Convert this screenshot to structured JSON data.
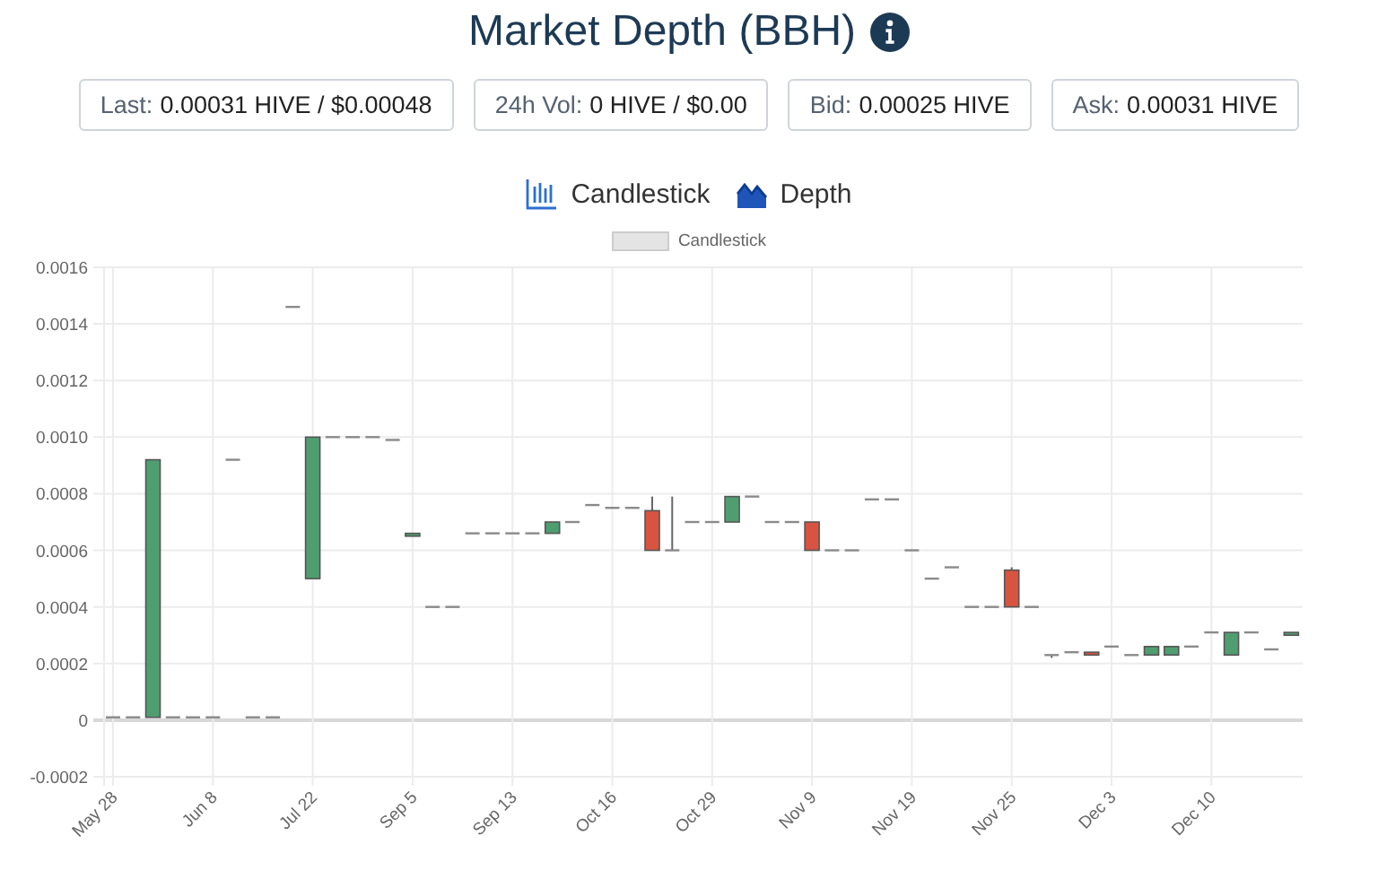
{
  "title": "Market Depth (BBH)",
  "stats": [
    {
      "label": "Last:",
      "value": "0.00031 HIVE / $0.00048"
    },
    {
      "label": "24h Vol:",
      "value": "0 HIVE / $0.00"
    },
    {
      "label": "Bid:",
      "value": "0.00025 HIVE"
    },
    {
      "label": "Ask:",
      "value": "0.00031 HIVE"
    }
  ],
  "chart_types": [
    {
      "kind": "candlestick",
      "label": "Candlestick"
    },
    {
      "kind": "depth",
      "label": "Depth"
    }
  ],
  "chart": {
    "chart_data": {
      "type": "candlestick",
      "grid": true,
      "categories": [
        "May 28",
        null,
        null,
        null,
        null,
        "Jun 8",
        null,
        null,
        null,
        null,
        "Jul 22",
        null,
        null,
        null,
        null,
        "Sep 5",
        null,
        null,
        null,
        null,
        "Sep 13",
        null,
        null,
        null,
        null,
        "Oct 16",
        null,
        null,
        null,
        null,
        "Oct 29",
        null,
        null,
        null,
        null,
        "Nov 9",
        null,
        null,
        null,
        null,
        "Nov 19",
        null,
        null,
        null,
        null,
        "Nov 25",
        null,
        null,
        null,
        null,
        "Dec 3",
        null,
        null,
        null,
        null,
        "Dec 10",
        null,
        null,
        null,
        null
      ],
      "ylim": [
        -0.0002,
        0.0016
      ],
      "yticks": [
        {
          "value": -0.0002,
          "label": "-0.0002"
        },
        {
          "value": 0,
          "label": "0"
        },
        {
          "value": 0.0002,
          "label": "0.0002"
        },
        {
          "value": 0.0004,
          "label": "0.0004"
        },
        {
          "value": 0.0006,
          "label": "0.0006"
        },
        {
          "value": 0.0008,
          "label": "0.0008"
        },
        {
          "value": 0.001,
          "label": "0.0010"
        },
        {
          "value": 0.0012,
          "label": "0.0012"
        },
        {
          "value": 0.0014,
          "label": "0.0014"
        },
        {
          "value": 0.0016,
          "label": "0.0016"
        }
      ],
      "series": [
        {
          "name": "Candlestick",
          "ohlc": [
            [
              1e-05,
              1e-05,
              1e-05,
              1e-05
            ],
            [
              1e-05,
              1e-05,
              1e-05,
              1e-05
            ],
            [
              1e-05,
              0.00092,
              1e-05,
              0.00092
            ],
            [
              1e-05,
              1e-05,
              1e-05,
              1e-05
            ],
            [
              1e-05,
              1e-05,
              1e-05,
              1e-05
            ],
            [
              1e-05,
              1e-05,
              1e-05,
              1e-05
            ],
            [
              0.00092,
              0.00092,
              0.00092,
              0.00092
            ],
            [
              1e-05,
              1e-05,
              1e-05,
              1e-05
            ],
            [
              1e-05,
              1e-05,
              1e-05,
              1e-05
            ],
            [
              0.00146,
              0.00146,
              0.00146,
              0.00146
            ],
            [
              0.0005,
              0.001,
              0.0005,
              0.001
            ],
            [
              0.001,
              0.001,
              0.001,
              0.001
            ],
            [
              0.001,
              0.001,
              0.001,
              0.001
            ],
            [
              0.001,
              0.001,
              0.001,
              0.001
            ],
            [
              0.00099,
              0.00099,
              0.00099,
              0.00099
            ],
            [
              0.00065,
              0.00066,
              0.00065,
              0.00066
            ],
            [
              0.0004,
              0.0004,
              0.0004,
              0.0004
            ],
            [
              0.0004,
              0.0004,
              0.0004,
              0.0004
            ],
            [
              0.00066,
              0.00066,
              0.00066,
              0.00066
            ],
            [
              0.00066,
              0.00066,
              0.00066,
              0.00066
            ],
            [
              0.00066,
              0.00066,
              0.00066,
              0.00066
            ],
            [
              0.00066,
              0.00066,
              0.00066,
              0.00066
            ],
            [
              0.00066,
              0.0007,
              0.00066,
              0.0007
            ],
            [
              0.0007,
              0.0007,
              0.0007,
              0.0007
            ],
            [
              0.00076,
              0.00076,
              0.00076,
              0.00076
            ],
            [
              0.00075,
              0.00075,
              0.00075,
              0.00075
            ],
            [
              0.00075,
              0.00075,
              0.00075,
              0.00075
            ],
            [
              0.00074,
              0.00079,
              0.0006,
              0.0006
            ],
            [
              0.0006,
              0.00079,
              0.0006,
              0.0006
            ],
            [
              0.0007,
              0.0007,
              0.0007,
              0.0007
            ],
            [
              0.0007,
              0.0007,
              0.0007,
              0.0007
            ],
            [
              0.0007,
              0.00079,
              0.0007,
              0.00079
            ],
            [
              0.00079,
              0.00079,
              0.00079,
              0.00079
            ],
            [
              0.0007,
              0.0007,
              0.0007,
              0.0007
            ],
            [
              0.0007,
              0.0007,
              0.0007,
              0.0007
            ],
            [
              0.0007,
              0.0007,
              0.0006,
              0.0006
            ],
            [
              0.0006,
              0.0006,
              0.0006,
              0.0006
            ],
            [
              0.0006,
              0.0006,
              0.0006,
              0.0006
            ],
            [
              0.00078,
              0.00078,
              0.00078,
              0.00078
            ],
            [
              0.00078,
              0.00078,
              0.00078,
              0.00078
            ],
            [
              0.0006,
              0.0006,
              0.0006,
              0.0006
            ],
            [
              0.0005,
              0.0005,
              0.0005,
              0.0005
            ],
            [
              0.00054,
              0.00054,
              0.00054,
              0.00054
            ],
            [
              0.0004,
              0.0004,
              0.0004,
              0.0004
            ],
            [
              0.0004,
              0.0004,
              0.0004,
              0.0004
            ],
            [
              0.00053,
              0.00054,
              0.0004,
              0.0004
            ],
            [
              0.0004,
              0.0004,
              0.0004,
              0.0004
            ],
            [
              0.00023,
              0.00023,
              0.00022,
              0.00023
            ],
            [
              0.00024,
              0.00024,
              0.00024,
              0.00024
            ],
            [
              0.00024,
              0.00024,
              0.00023,
              0.00023
            ],
            [
              0.00026,
              0.00026,
              0.00026,
              0.00026
            ],
            [
              0.00023,
              0.00023,
              0.00023,
              0.00023
            ],
            [
              0.00023,
              0.00026,
              0.00023,
              0.00026
            ],
            [
              0.00023,
              0.00026,
              0.00023,
              0.00026
            ],
            [
              0.00026,
              0.00026,
              0.00026,
              0.00026
            ],
            [
              0.00031,
              0.00031,
              0.00031,
              0.00031
            ],
            [
              0.00023,
              0.00031,
              0.00023,
              0.00031
            ],
            [
              0.00031,
              0.00031,
              0.00031,
              0.00031
            ],
            [
              0.00025,
              0.00025,
              0.00025,
              0.00025
            ],
            [
              0.0003,
              0.00031,
              0.0003,
              0.00031
            ]
          ]
        }
      ]
    }
  }
}
